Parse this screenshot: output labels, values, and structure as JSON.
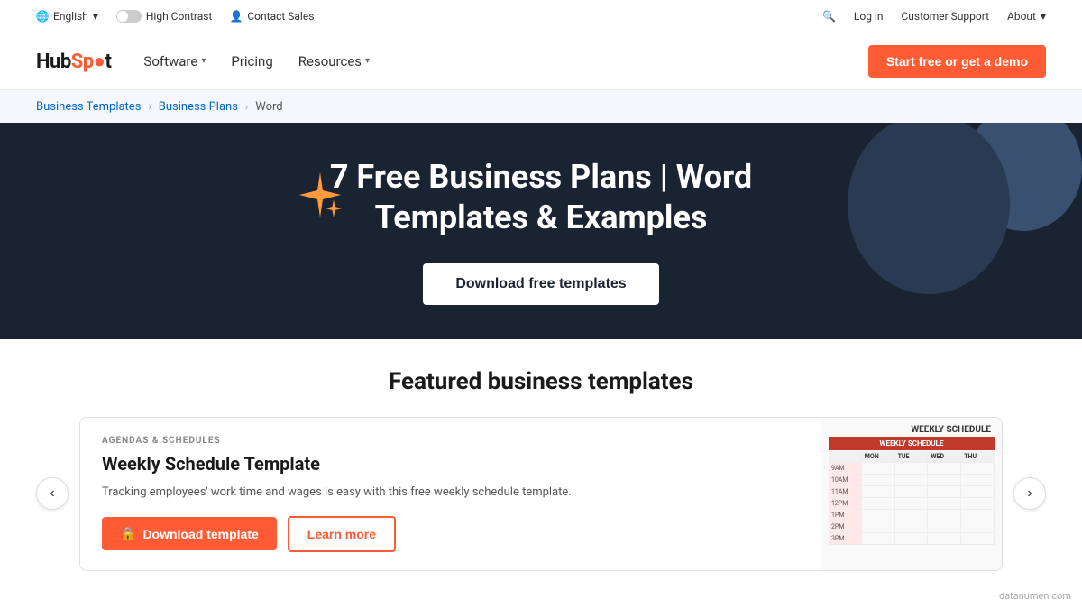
{
  "utility": {
    "language": "English",
    "high_contrast": "High Contrast",
    "contact_sales": "Contact Sales",
    "login": "Log in",
    "customer_support": "Customer Support",
    "about": "About"
  },
  "nav": {
    "logo": "HubSpot",
    "logo_dot": "o",
    "software": "Software",
    "pricing": "Pricing",
    "resources": "Resources",
    "cta": "Start free or get a demo"
  },
  "breadcrumb": {
    "templates": "Business Templates",
    "plans": "Business Plans",
    "current": "Word"
  },
  "hero": {
    "title": "7 Free Business Plans | Word Templates & Examples",
    "cta": "Download free templates"
  },
  "featured": {
    "title": "Featured business templates",
    "card": {
      "category": "AGENDAS & SCHEDULES",
      "title": "Weekly Schedule Template",
      "description": "Tracking employees' work time and wages is easy with this free weekly schedule template.",
      "download_btn": "Download template",
      "learn_btn": "Learn more",
      "sheet_label": "WEEKLY SCHEDULE",
      "sheet_title": "WEEKLY SCHEDULE"
    }
  },
  "watermark": "datanumen.com",
  "icons": {
    "chevron_down": "▾",
    "chevron_right": "›",
    "chevron_left": "‹",
    "lock": "🔒",
    "user": "👤",
    "globe": "🌐",
    "search": "🔍"
  }
}
